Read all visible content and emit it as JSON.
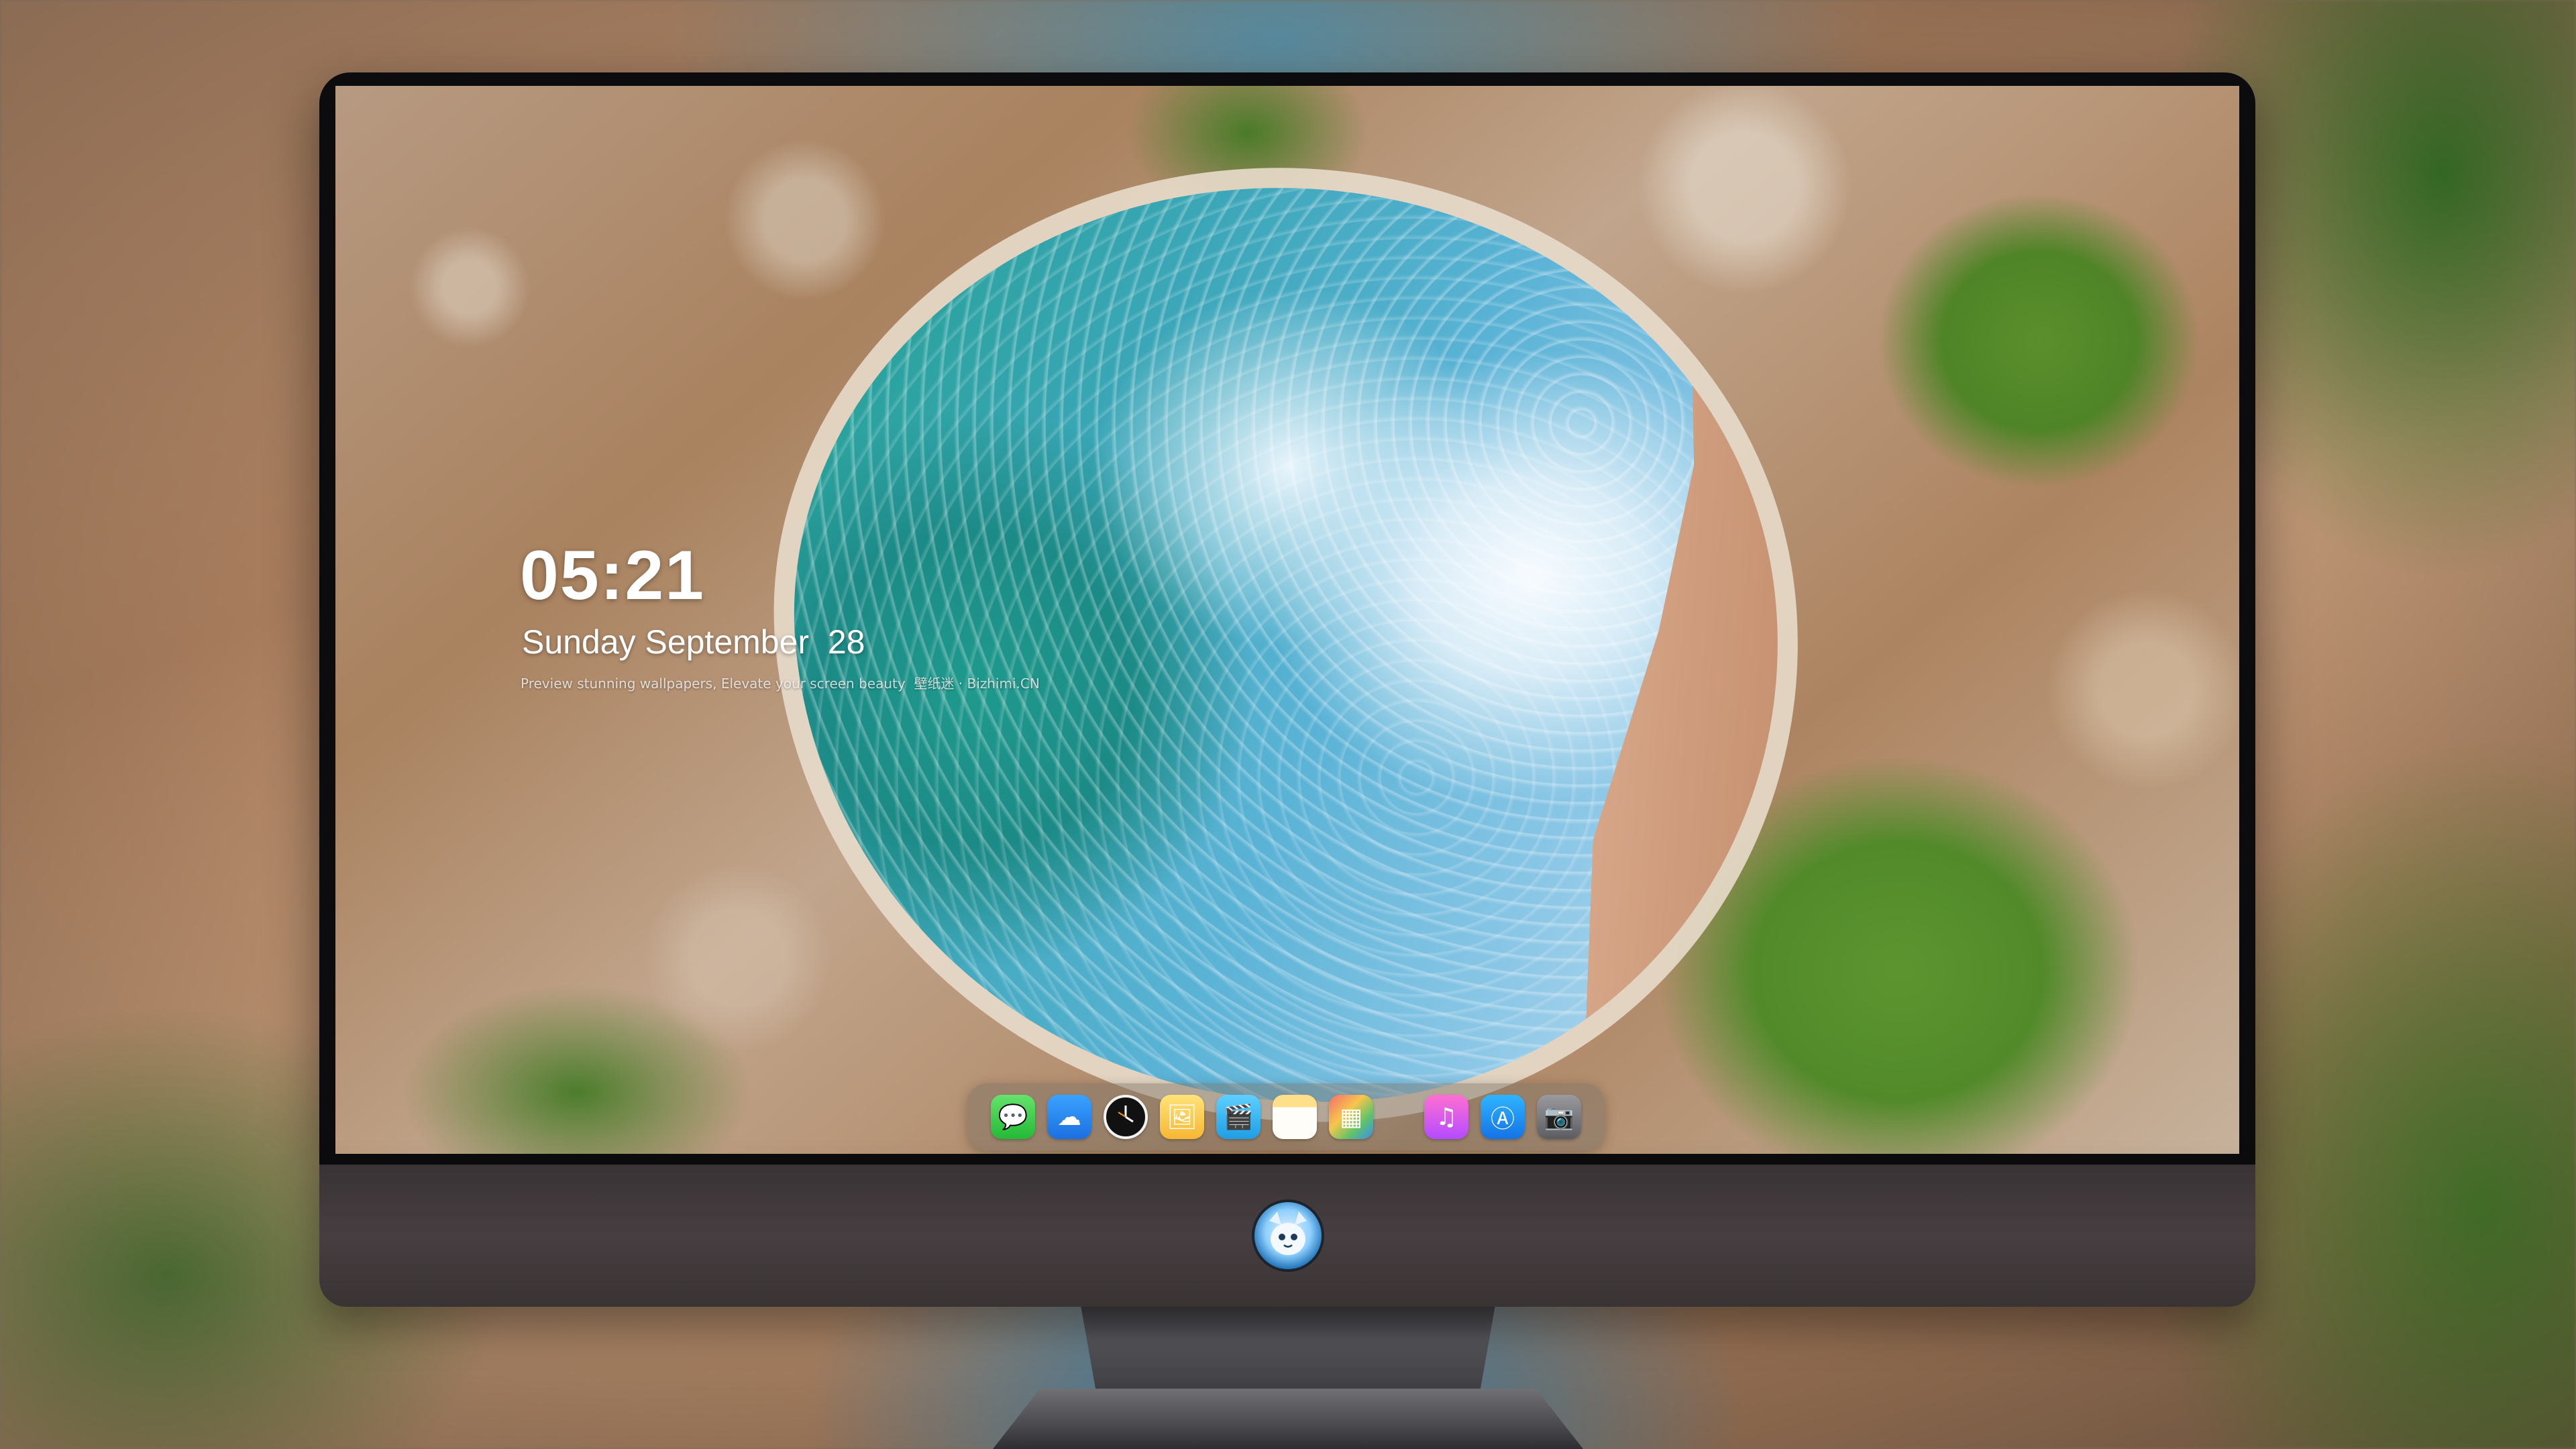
{
  "lock_screen": {
    "time": "05:21",
    "date": "Sunday September  28",
    "tagline": "Preview stunning wallpapers, Elevate your screen beauty  壁纸迷 · Bizhimi.CN"
  },
  "dock": {
    "apps": [
      {
        "name": "Messages",
        "icon": "message-bubble-icon",
        "glyph": "💬"
      },
      {
        "name": "Weather",
        "icon": "cloud-icon",
        "glyph": "☁"
      },
      {
        "name": "Clock",
        "icon": "clock-icon",
        "glyph": "🕔"
      },
      {
        "name": "Preview",
        "icon": "preview-icon",
        "glyph": "🖼"
      },
      {
        "name": "Clips",
        "icon": "clapperboard-icon",
        "glyph": "🎬"
      },
      {
        "name": "Notes",
        "icon": "notes-icon",
        "glyph": ""
      },
      {
        "name": "Photo Booth",
        "icon": "photos-icon",
        "glyph": "▦"
      },
      {
        "name": "Music",
        "icon": "music-note-icon",
        "glyph": "♫"
      },
      {
        "name": "App Store",
        "icon": "app-store-icon",
        "glyph": "Ⓐ"
      },
      {
        "name": "Camera",
        "icon": "camera-icon",
        "glyph": "📷"
      }
    ]
  },
  "colors": {
    "bezel": "#0c0c0e",
    "chin": "#3f3739",
    "time_text": "#ffffff"
  }
}
